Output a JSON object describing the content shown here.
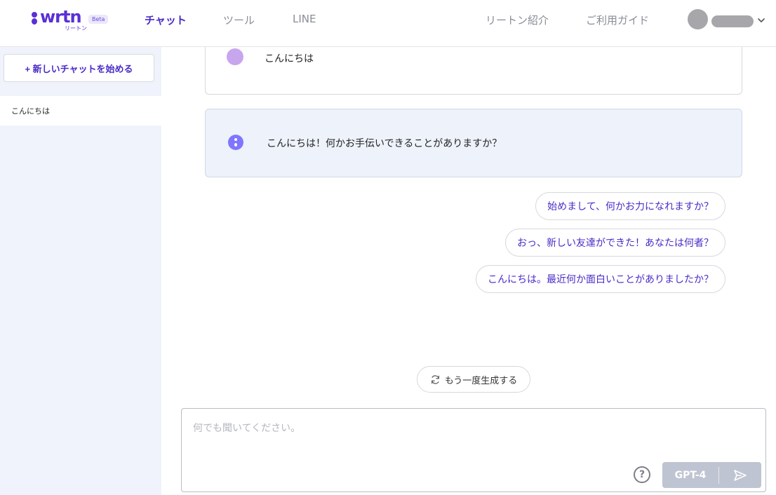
{
  "header": {
    "logo_text": "wrtn",
    "logo_sub": "リートン",
    "beta_label": "Beta",
    "nav": [
      {
        "label": "チャット",
        "active": true
      },
      {
        "label": "ツール",
        "active": false
      },
      {
        "label": "LINE",
        "active": false
      }
    ],
    "right_nav": [
      {
        "label": "リートン紹介"
      },
      {
        "label": "ご利用ガイド"
      }
    ],
    "profile": {
      "avatar_icon": "avatar-placeholder",
      "menu_icon": "chevron-down-icon"
    }
  },
  "sidebar": {
    "new_chat_label": "+ 新しいチャットを始める",
    "history": [
      {
        "label": "こんにちは"
      }
    ]
  },
  "chat": {
    "messages": [
      {
        "role": "user",
        "text": "こんにちは"
      },
      {
        "role": "assistant",
        "text": "こんにちは！何かお手伝いできることがありますか？"
      }
    ],
    "suggestions": [
      {
        "label": "始めまして、何かお力になれますか？"
      },
      {
        "label": "おっ、新しい友達ができた！あなたは何者？"
      },
      {
        "label": "こんにちは。最近何か面白いことがありましたか？"
      }
    ],
    "regenerate_label": "もう一度生成する"
  },
  "composer": {
    "value": "",
    "placeholder": "何でも聞いてください。",
    "help_label": "?",
    "model_label": "GPT-4",
    "send_icon": "send-icon"
  },
  "colors": {
    "brand": "#5a2fd6",
    "accent_text": "#4a2bc7",
    "sidebar_bg": "#f0f3fb",
    "assistant_bg": "#eef2fb",
    "send_disabled": "#bfc4d2"
  }
}
